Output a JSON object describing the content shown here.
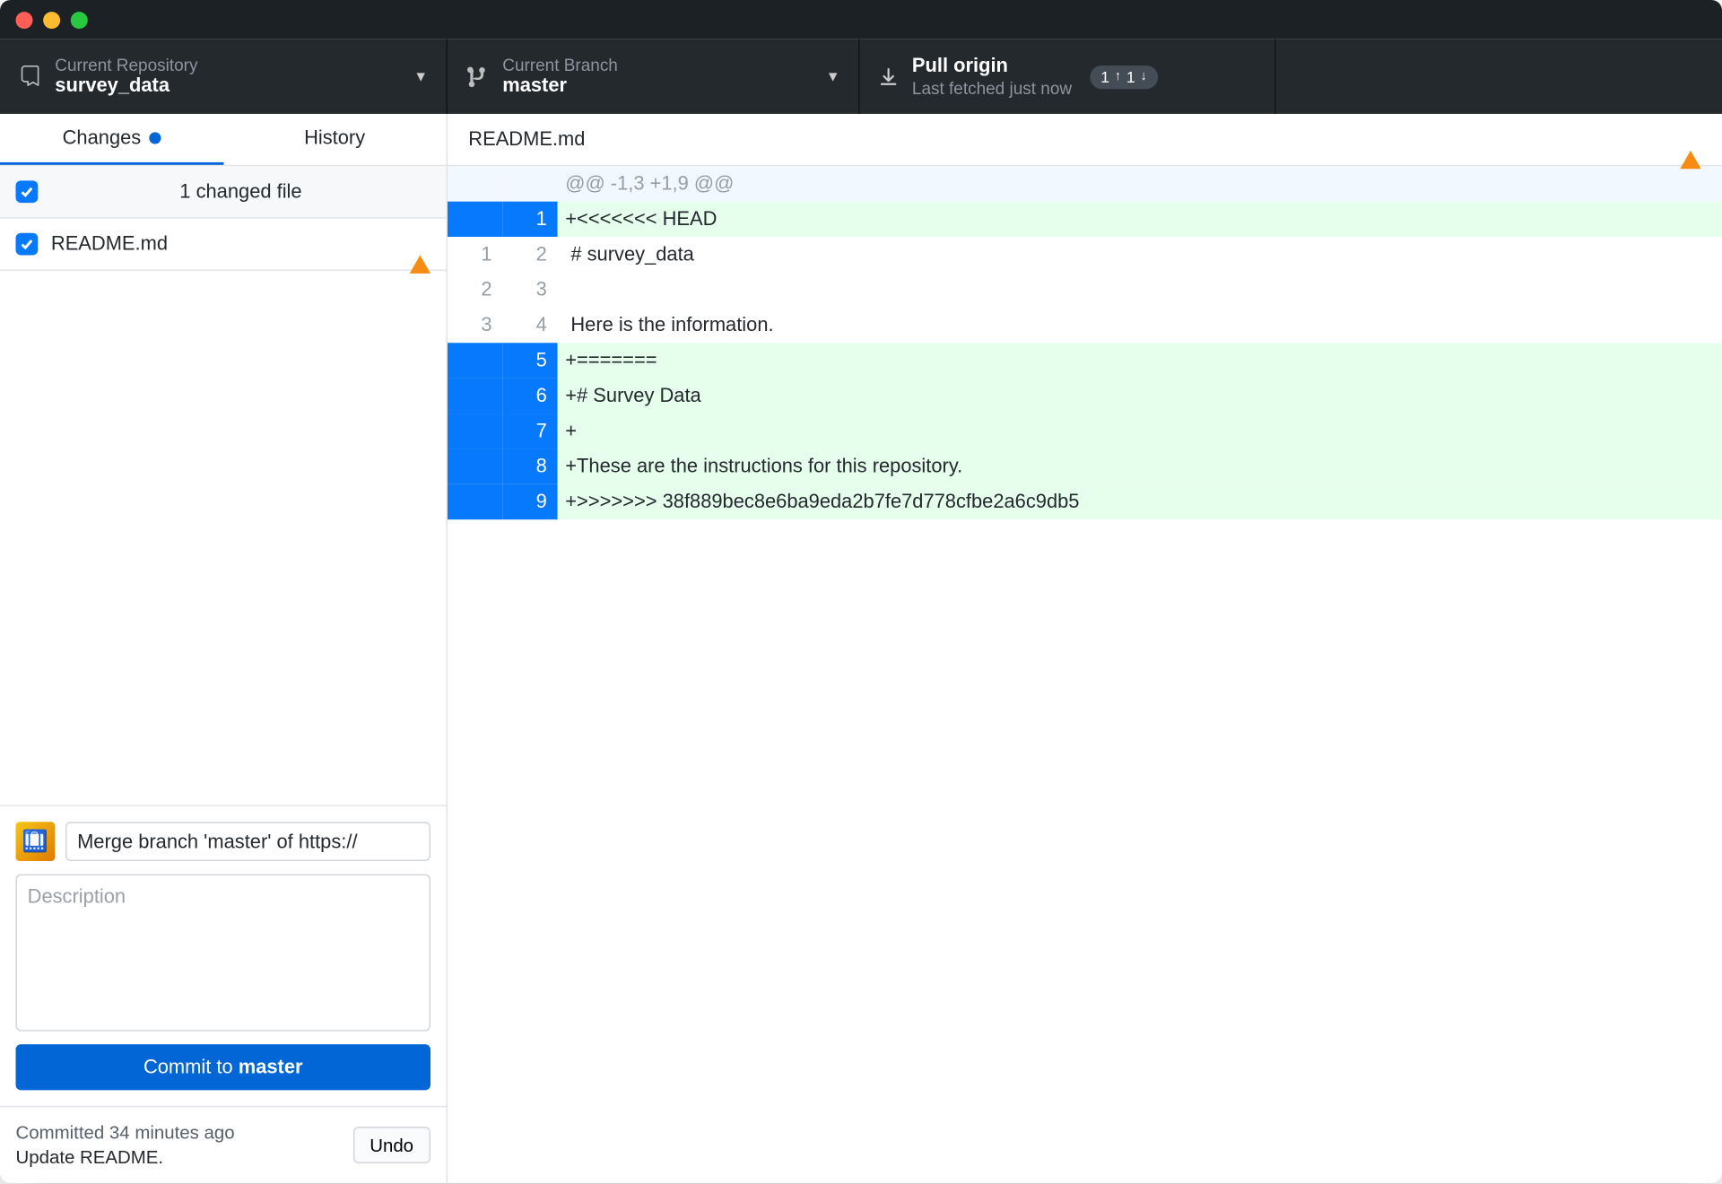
{
  "toolbar": {
    "repo": {
      "label": "Current Repository",
      "value": "survey_data"
    },
    "branch": {
      "label": "Current Branch",
      "value": "master"
    },
    "pull": {
      "label": "Pull origin",
      "sub": "Last fetched just now",
      "up": "1",
      "down": "1"
    }
  },
  "tabs": {
    "changes": "Changes",
    "history": "History"
  },
  "files": {
    "countLabel": "1 changed file",
    "items": [
      {
        "name": "README.md"
      }
    ]
  },
  "commit": {
    "summary": "Merge branch 'master' of https://",
    "descPlaceholder": "Description",
    "buttonPrefix": "Commit to ",
    "buttonBranch": "master"
  },
  "lastCommit": {
    "time": "Committed 34 minutes ago",
    "message": "Update README.",
    "undo": "Undo"
  },
  "diff": {
    "filename": "README.md",
    "hunk": "@@ -1,3 +1,9 @@",
    "rows": [
      {
        "type": "add",
        "old": "",
        "new": "1",
        "sel": true,
        "text": "+<<<<<<< HEAD"
      },
      {
        "type": "ctx",
        "old": "1",
        "new": "2",
        "sel": false,
        "text": " # survey_data"
      },
      {
        "type": "ctx",
        "old": "2",
        "new": "3",
        "sel": false,
        "text": " "
      },
      {
        "type": "ctx",
        "old": "3",
        "new": "4",
        "sel": false,
        "text": " Here is the information."
      },
      {
        "type": "add",
        "old": "",
        "new": "5",
        "sel": true,
        "text": "+======="
      },
      {
        "type": "add",
        "old": "",
        "new": "6",
        "sel": true,
        "text": "+# Survey Data"
      },
      {
        "type": "add",
        "old": "",
        "new": "7",
        "sel": true,
        "text": "+"
      },
      {
        "type": "add",
        "old": "",
        "new": "8",
        "sel": true,
        "text": "+These are the instructions for this repository."
      },
      {
        "type": "add",
        "old": "",
        "new": "9",
        "sel": true,
        "text": "+>>>>>>> 38f889bec8e6ba9eda2b7fe7d778cfbe2a6c9db5"
      }
    ]
  }
}
